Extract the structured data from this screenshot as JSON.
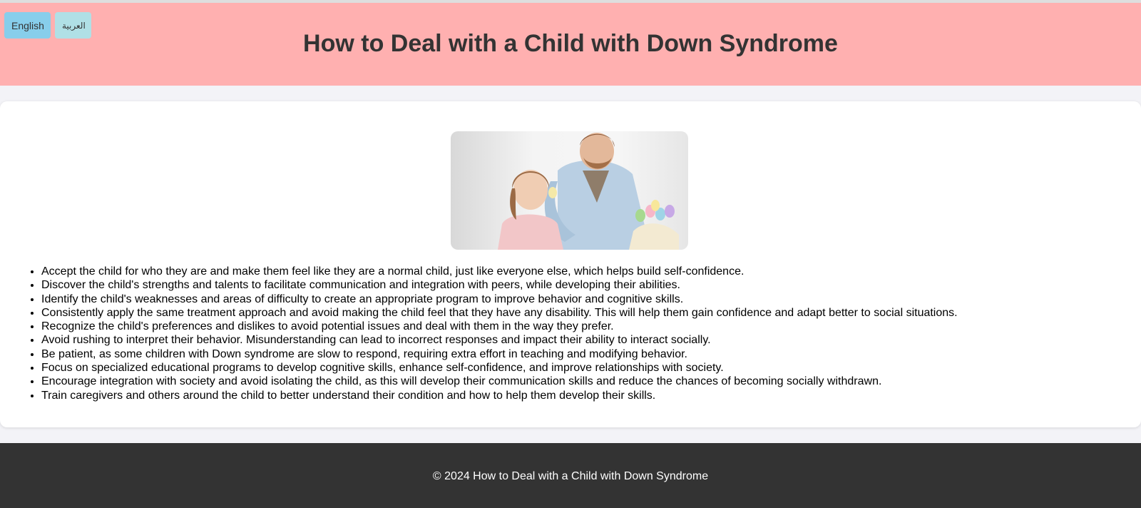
{
  "header": {
    "title": "How to Deal with a Child with Down Syndrome",
    "lang_buttons": {
      "english": "English",
      "arabic": "العربية"
    },
    "background": "#ffb0b0"
  },
  "main": {
    "image": {
      "description_icon": "photo-icon"
    },
    "tips": [
      "Accept the child for who they are and make them feel like they are a normal child, just like everyone else, which helps build self-confidence.",
      "Discover the child's strengths and talents to facilitate communication and integration with peers, while developing their abilities.",
      "Identify the child's weaknesses and areas of difficulty to create an appropriate program to improve behavior and cognitive skills.",
      "Consistently apply the same treatment approach and avoid making the child feel that they have any disability. This will help them gain confidence and adapt better to social situations.",
      "Recognize the child's preferences and dislikes to avoid potential issues and deal with them in the way they prefer.",
      "Avoid rushing to interpret their behavior. Misunderstanding can lead to incorrect responses and impact their ability to interact socially.",
      "Be patient, as some children with Down syndrome are slow to respond, requiring extra effort in teaching and modifying behavior.",
      "Focus on specialized educational programs to develop cognitive skills, enhance self-confidence, and improve relationships with society.",
      "Encourage integration with society and avoid isolating the child, as this will develop their communication skills and reduce the chances of becoming socially withdrawn.",
      "Train caregivers and others around the child to better understand their condition and how to help them develop their skills."
    ]
  },
  "footer": {
    "text": "© 2024 How to Deal with a Child with Down Syndrome",
    "background": "#333333"
  }
}
